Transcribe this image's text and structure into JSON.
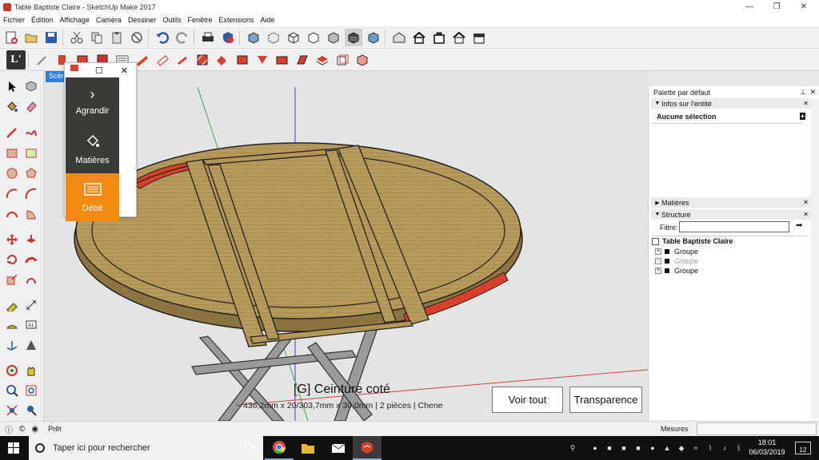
{
  "window": {
    "title": "Table Baptiste Claire - SketchUp Make 2017",
    "min_label": "—",
    "max_label": "❐",
    "close_label": "✕"
  },
  "menu": [
    "Fichier",
    "Édition",
    "Affichage",
    "Caméra",
    "Dessiner",
    "Outils",
    "Fenêtre",
    "Extensions",
    "Aide"
  ],
  "viewport": {
    "scene_tab": "Scène",
    "selection_title": "[G] Ceinture coté",
    "selection_dims": "~ 436,2mm x 20/303,7mm x 30,0mm | 2 pièces | Chene",
    "buttons": {
      "voir_tout": "Voir tout",
      "transparence": "Transparence"
    }
  },
  "popup": {
    "items": [
      {
        "label": "Agrandir",
        "icon": "chevron-right-icon"
      },
      {
        "label": "Matières",
        "icon": "paint-bucket-icon"
      },
      {
        "label": "Débit",
        "icon": "list-icon"
      }
    ],
    "max_glyph": "☐",
    "close_glyph": "✕"
  },
  "tray": {
    "title": "Palette par défaut",
    "entity_info": {
      "label": "Infos sur l'entité",
      "selection": "Aucune sélection"
    },
    "materials_label": "Matières",
    "structure": {
      "label": "Structure",
      "filter_label": "Filtre:",
      "filter_value": "",
      "model_name": "Table Baptiste Claire",
      "groups": [
        {
          "label": "Groupe",
          "greyed": false
        },
        {
          "label": "Groupe",
          "greyed": true
        },
        {
          "label": "Groupe",
          "greyed": false
        }
      ]
    }
  },
  "status": {
    "text": "Prêt",
    "measures_label": "Mesures",
    "measures_value": ""
  },
  "taskbar": {
    "search_placeholder": "Taper ici pour rechercher",
    "time": "18:01",
    "date": "06/03/2019",
    "notification_count": "12"
  },
  "colors": {
    "accent_orange": "#f28a12",
    "popup_dark": "#3c3a36",
    "wood": "#b59a5c",
    "highlight_red": "#d8402a",
    "selection_blue": "#2f7fd6"
  }
}
